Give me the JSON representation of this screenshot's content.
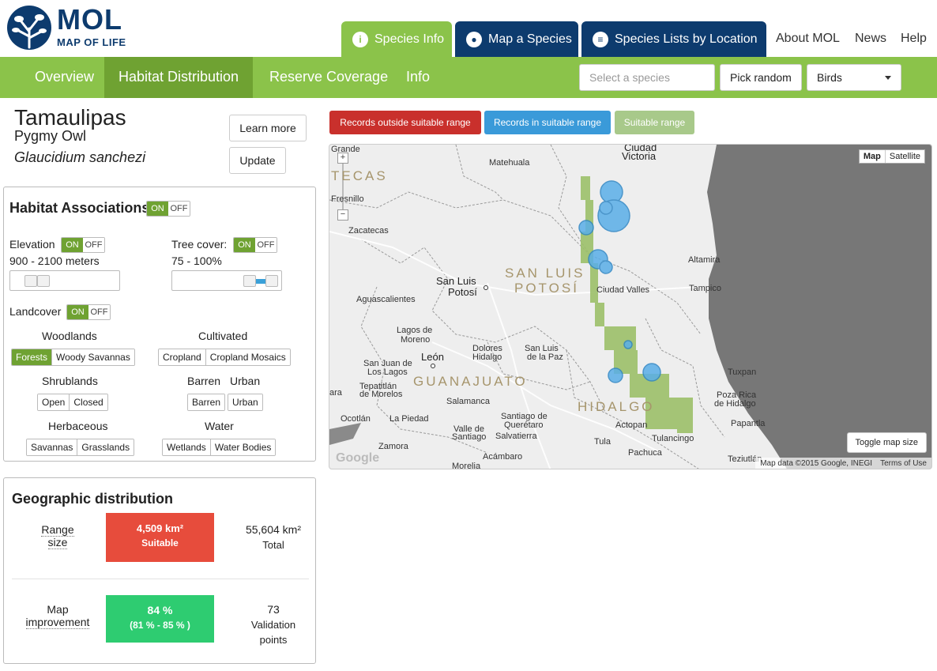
{
  "brand": {
    "title": "MOL",
    "subtitle": "MAP OF LIFE"
  },
  "main_tabs": [
    {
      "label": "Species Info",
      "icon": "info-icon"
    },
    {
      "label": "Map a Species",
      "icon": "map-pin-icon"
    },
    {
      "label": "Species Lists by Location",
      "icon": "list-icon"
    }
  ],
  "top_links": [
    "About MOL",
    "News",
    "Help"
  ],
  "subnav": {
    "items": [
      "Overview",
      "Habitat Distribution",
      "Reserve Coverage",
      "Info"
    ],
    "active": "Habitat Distribution",
    "search_placeholder": "Select a species",
    "pick_random": "Pick random",
    "taxon_select": "Birds"
  },
  "species": {
    "title": "Tamaulipas",
    "common": "Pygmy Owl",
    "scientific": "Glaucidium sanchezi",
    "learn_more": "Learn more",
    "update": "Update"
  },
  "habitat": {
    "title": "Habitat Associations",
    "on": "ON",
    "off": "OFF",
    "elevation_label": "Elevation",
    "elevation_range": "900 - 2100 meters",
    "tree_label": "Tree cover:",
    "tree_range": "75 - 100%",
    "landcover_label": "Landcover",
    "groups": {
      "woodlands": {
        "title": "Woodlands",
        "items": [
          "Forests",
          "Woody Savannas"
        ]
      },
      "cultivated": {
        "title": "Cultivated",
        "items": [
          "Cropland",
          "Cropland Mosaics"
        ]
      },
      "shrublands": {
        "title": "Shrublands",
        "items": [
          "Open",
          "Closed"
        ]
      },
      "barren": {
        "title": "Barren",
        "items": [
          "Barren"
        ]
      },
      "urban": {
        "title": "Urban",
        "items": [
          "Urban"
        ]
      },
      "herbaceous": {
        "title": "Herbaceous",
        "items": [
          "Savannas",
          "Grasslands"
        ]
      },
      "water": {
        "title": "Water",
        "items": [
          "Wetlands",
          "Water Bodies"
        ]
      }
    }
  },
  "legend": {
    "outside": "Records outside suitable range",
    "inside": "Records in suitable range",
    "suitable": "Suitable range",
    "colors": {
      "outside": "#c9302c",
      "inside": "#3a9ad9",
      "suitable": "#a8c98a"
    }
  },
  "map": {
    "type_map": "Map",
    "type_satellite": "Satellite",
    "toggle": "Toggle map size",
    "attribution": "Map data ©2015 Google, INEGI",
    "terms": "Terms of Use",
    "google": "Google",
    "states": [
      "TECAS",
      "SAN LUIS",
      "POTOSÍ",
      "GUANAJUATO",
      "HIDALGO"
    ],
    "places": [
      "Grande",
      "Ciudad",
      "Victoria",
      "Matehuala",
      "Fresnillo",
      "Zacatecas",
      "Altamira",
      "San Luis",
      "Potosí",
      "Ciudad Valles",
      "Tampico",
      "Aguascalientes",
      "Lagos de",
      "Moreno",
      "León",
      "Dolores",
      "Hidalgo",
      "San Luis",
      "de la Paz",
      "San Juan de",
      "Los Lagos",
      "Tepatitlán",
      "de Morelos",
      "ara",
      "Tuxpan",
      "Poza Rica",
      "de Hidalgo",
      "Salamanca",
      "Ocotlán",
      "La Piedad",
      "Santiago de",
      "Querétaro",
      "Valle de",
      "Santiago",
      "Salvatierra",
      "Actopan",
      "Papantla",
      "Tula",
      "Tulancingo",
      "Zamora",
      "Pachuca",
      "Acámbaro",
      "Morelia",
      "Teziutlán"
    ]
  },
  "geo": {
    "title": "Geographic distribution",
    "range_label": "Range size",
    "suitable_value": "4,509 km²",
    "suitable_label": "Suitable",
    "total_value": "55,604 km²",
    "total_label": "Total",
    "improvement_label_1": "Map",
    "improvement_label_2": "improvement",
    "improvement_value": "84 %",
    "improvement_ci": "(81 %  -  85 % )",
    "validation_count": "73",
    "validation_label_1": "Validation",
    "validation_label_2": "points"
  }
}
